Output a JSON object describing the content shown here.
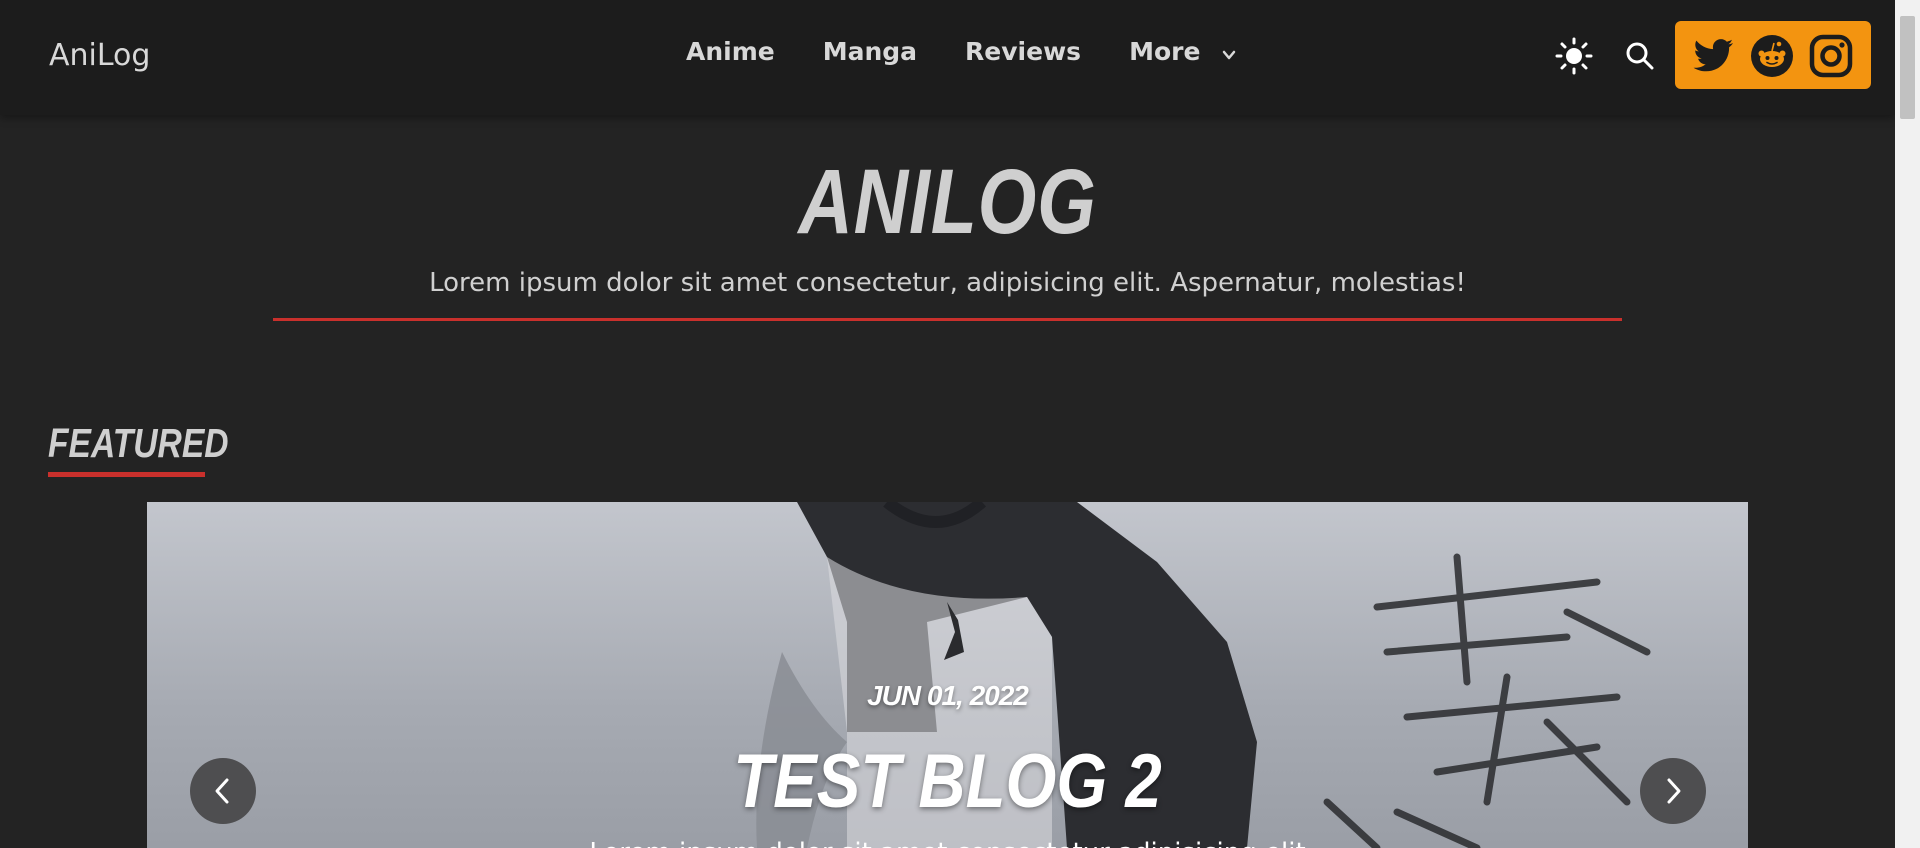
{
  "nav": {
    "brand": "AniLog",
    "links": [
      {
        "label": "Anime"
      },
      {
        "label": "Manga"
      },
      {
        "label": "Reviews"
      },
      {
        "label": "More"
      }
    ],
    "icons": {
      "theme": "sun-icon",
      "search": "search-icon",
      "social": [
        "twitter-icon",
        "reddit-icon",
        "instagram-icon"
      ]
    }
  },
  "hero": {
    "title": "ANILOG",
    "subtitle": "Lorem ipsum dolor sit amet consectetur, adipisicing elit. Aspernatur, molestias!"
  },
  "featured": {
    "heading": "FEATURED",
    "slide": {
      "date": "JUN 01, 2022",
      "title": "TEST BLOG 2",
      "excerpt": "Lorem ipsum dolor sit amet consectetur adipisicing elit"
    }
  },
  "colors": {
    "accent_red": "#c9302c",
    "social_orange": "#f39410",
    "background": "#232323",
    "navbar": "#1c1c1c"
  }
}
